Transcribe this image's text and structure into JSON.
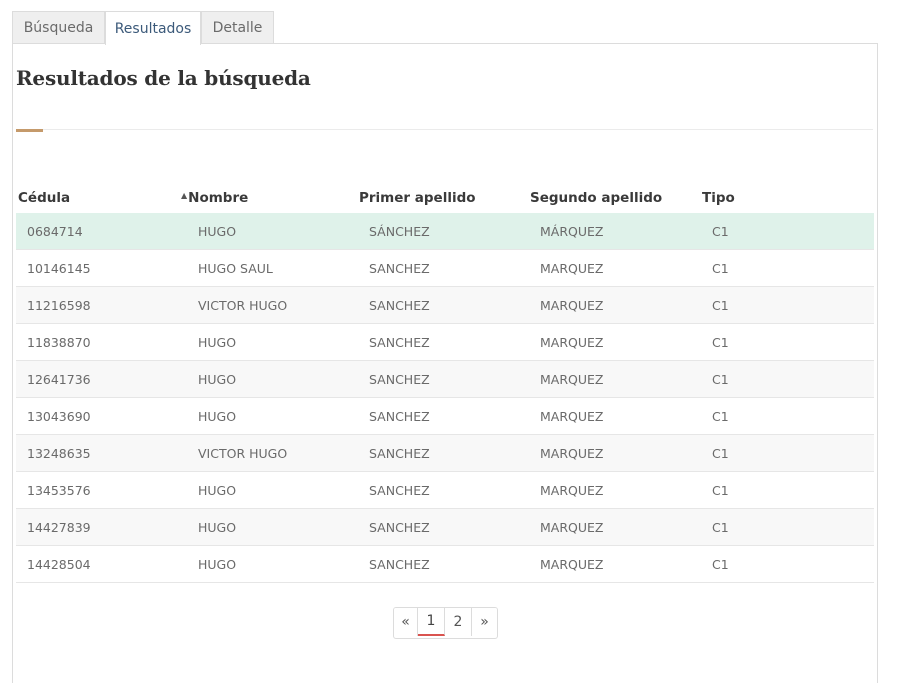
{
  "tabs": [
    {
      "label": "Búsqueda"
    },
    {
      "label": "Resultados"
    },
    {
      "label": "Detalle"
    }
  ],
  "title": "Resultados de la búsqueda",
  "table": {
    "headers": {
      "cedula": "Cédula",
      "nombre": "Nombre",
      "ap1": "Primer apellido",
      "ap2": "Segundo apellido",
      "tipo": "Tipo"
    },
    "sort_indicator": "▲",
    "rows": [
      {
        "cedula": "0684714",
        "nombre": "HUGO",
        "ap1": "SÁNCHEZ",
        "ap2": "MÁRQUEZ",
        "tipo": "C1"
      },
      {
        "cedula": "10146145",
        "nombre": "HUGO SAUL",
        "ap1": "SANCHEZ",
        "ap2": "MARQUEZ",
        "tipo": "C1"
      },
      {
        "cedula": "11216598",
        "nombre": "VICTOR HUGO",
        "ap1": "SANCHEZ",
        "ap2": "MARQUEZ",
        "tipo": "C1"
      },
      {
        "cedula": "11838870",
        "nombre": "HUGO",
        "ap1": "SANCHEZ",
        "ap2": "MARQUEZ",
        "tipo": "C1"
      },
      {
        "cedula": "12641736",
        "nombre": "HUGO",
        "ap1": "SANCHEZ",
        "ap2": "MARQUEZ",
        "tipo": "C1"
      },
      {
        "cedula": "13043690",
        "nombre": "HUGO",
        "ap1": "SANCHEZ",
        "ap2": "MARQUEZ",
        "tipo": "C1"
      },
      {
        "cedula": "13248635",
        "nombre": "VICTOR HUGO",
        "ap1": "SANCHEZ",
        "ap2": "MARQUEZ",
        "tipo": "C1"
      },
      {
        "cedula": "13453576",
        "nombre": "HUGO",
        "ap1": "SANCHEZ",
        "ap2": "MARQUEZ",
        "tipo": "C1"
      },
      {
        "cedula": "14427839",
        "nombre": "HUGO",
        "ap1": "SANCHEZ",
        "ap2": "MARQUEZ",
        "tipo": "C1"
      },
      {
        "cedula": "14428504",
        "nombre": "HUGO",
        "ap1": "SANCHEZ",
        "ap2": "MARQUEZ",
        "tipo": "C1"
      }
    ]
  },
  "pagination": {
    "prev": "«",
    "pages": [
      "1",
      "2"
    ],
    "next": "»",
    "current": "1"
  },
  "colors": {
    "selected_row": "#dff2ea",
    "accent": "#c59a6b",
    "current_page_underline": "#d9534f"
  }
}
